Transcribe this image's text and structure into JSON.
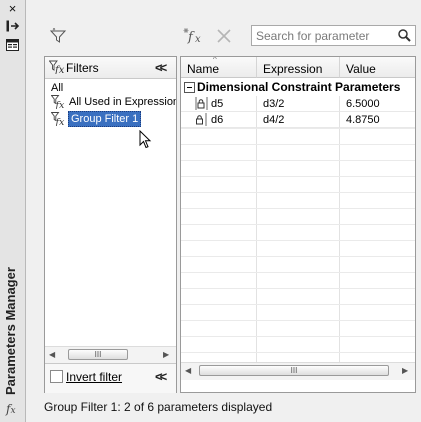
{
  "palette": "title-strip",
  "strip": {
    "title": "Parameters Manager",
    "close_icon": "×",
    "dock_icon": "⇥",
    "properties_icon": "▤",
    "fx_glyph": "fx"
  },
  "toolbar": {
    "search_placeholder": "Search for parameter"
  },
  "filters": {
    "title": "Filters",
    "items": [
      {
        "label": "All"
      },
      {
        "label": "All Used in Expressions"
      },
      {
        "label": "Group Filter 1",
        "selected": true
      }
    ],
    "invert_label": "Invert filter",
    "scroll_thumb_grip": "III"
  },
  "grid": {
    "columns": [
      "Name",
      "Expression",
      "Value"
    ],
    "group_header": "Dimensional Constraint Parameters",
    "rows": [
      {
        "name": "d5",
        "expression": "d3/2",
        "value": "6.5000"
      },
      {
        "name": "d6",
        "expression": "d4/2",
        "value": "4.8750"
      }
    ],
    "scroll_thumb_grip": "III"
  },
  "status": "Group Filter 1: 2 of 6 parameters displayed",
  "colors": {
    "selection_bg": "#3a70c0",
    "panel_border": "#9a9a9a"
  }
}
